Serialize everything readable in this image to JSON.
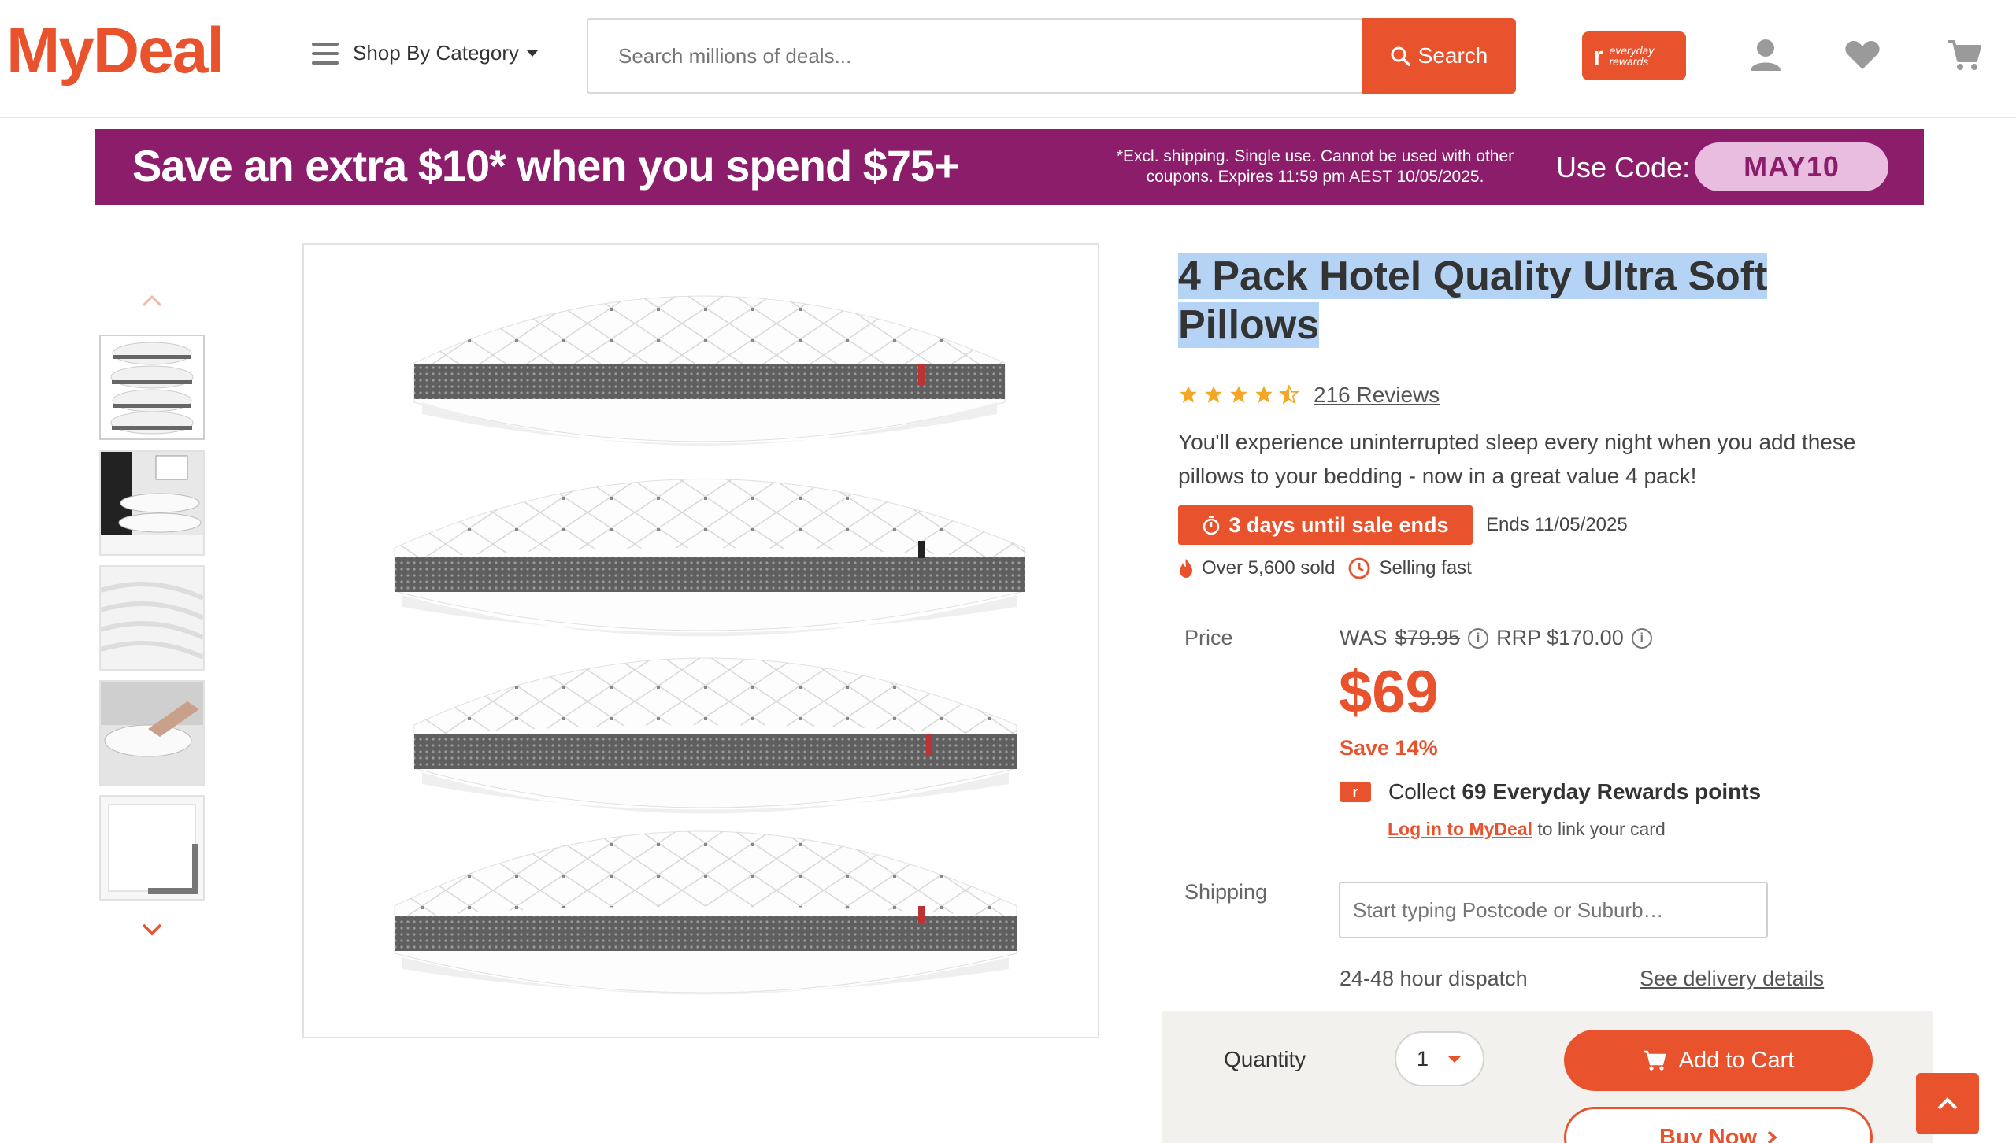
{
  "header": {
    "logo": "MyDeal",
    "menu_label": "Shop By Category",
    "search_placeholder": "Search millions of deals...",
    "search_button": "Search",
    "rewards_badge_line1": "everyday",
    "rewards_badge_line2": "rewards",
    "icons": [
      "account-icon",
      "heart-icon",
      "cart-icon"
    ]
  },
  "banner": {
    "headline": "Save an extra $10* when you spend $75+",
    "fine_print": "*Excl. shipping. Single use. Cannot be used with other coupons. Expires 11:59 pm AEST 10/05/2025.",
    "code_label": "Use Code:",
    "code": "MAY10"
  },
  "product": {
    "title": "4 Pack Hotel Quality Ultra Soft Pillows",
    "rating": 4.5,
    "reviews": "216 Reviews",
    "description": "You'll experience uninterrupted sleep every night when you add these pillows to your bedding - now in a great value 4 pack!",
    "sale_badge": "3 days until sale ends",
    "sale_ends": "Ends 11/05/2025",
    "sold": "Over 5,600 sold",
    "selling": "Selling fast",
    "price_label": "Price",
    "was_label": "WAS",
    "was_price": "$79.95",
    "rrp": "RRP $170.00",
    "price": "$69",
    "save": "Save 14%",
    "collect_prefix": "Collect",
    "collect_points": "69 Everyday Rewards points",
    "login_link": "Log in to MyDeal",
    "login_suffix": "to link your card",
    "shipping_label": "Shipping",
    "postcode_placeholder": "Start typing Postcode or Suburb…",
    "dispatch": "24-48 hour dispatch",
    "delivery_link": "See delivery details",
    "quantity_label": "Quantity",
    "quantity": "1",
    "add_to_cart": "Add to Cart",
    "buy_now": "Buy Now"
  },
  "colors": {
    "brand": "#e8522d",
    "banner": "#8b1d6b",
    "code_pill": "#e9bde0",
    "selection": "#b5d3f5"
  }
}
